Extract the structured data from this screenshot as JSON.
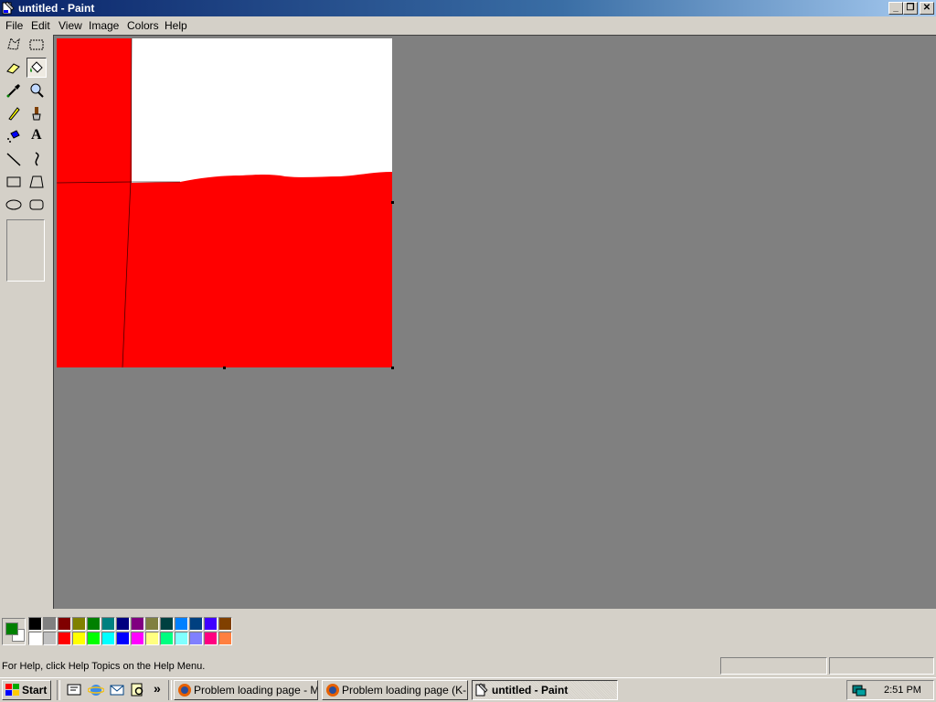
{
  "window": {
    "title": "untitled - Paint",
    "buttons": {
      "minimize": "_",
      "restore": "❐",
      "close": "✕"
    }
  },
  "menu": [
    "File",
    "Edit",
    "View",
    "Image",
    "Colors",
    "Help"
  ],
  "toolbox": {
    "tools": [
      {
        "name": "free-form-select-icon"
      },
      {
        "name": "select-icon"
      },
      {
        "name": "eraser-icon"
      },
      {
        "name": "fill-with-color-icon"
      },
      {
        "name": "pick-color-icon"
      },
      {
        "name": "magnifier-icon"
      },
      {
        "name": "pencil-icon"
      },
      {
        "name": "brush-icon"
      },
      {
        "name": "airbrush-icon"
      },
      {
        "name": "text-icon",
        "glyph": "A"
      },
      {
        "name": "line-icon"
      },
      {
        "name": "curve-icon"
      },
      {
        "name": "rectangle-icon"
      },
      {
        "name": "polygon-icon"
      },
      {
        "name": "ellipse-icon"
      },
      {
        "name": "rounded-rectangle-icon"
      }
    ],
    "selected_tool": "fill-with-color-icon"
  },
  "colors": {
    "foreground": "#008000",
    "background": "#ffffff",
    "workspace": "#808080",
    "canvas_red": "#ff0000",
    "palette_top": [
      "#000000",
      "#808080",
      "#800000",
      "#808000",
      "#008000",
      "#008080",
      "#000080",
      "#800080",
      "#808040",
      "#004040",
      "#0080ff",
      "#004080",
      "#4000ff",
      "#804000"
    ],
    "palette_bottom": [
      "#ffffff",
      "#c0c0c0",
      "#ff0000",
      "#ffff00",
      "#00ff00",
      "#00ffff",
      "#0000ff",
      "#ff00ff",
      "#ffff80",
      "#00ff80",
      "#80ffff",
      "#8080ff",
      "#ff0080",
      "#ff8040"
    ]
  },
  "status": {
    "help_text": "For Help, click Help Topics on the Help Menu."
  },
  "taskbar": {
    "start_label": "Start",
    "quick_launch": [
      "show-desktop-icon",
      "internet-explorer-icon",
      "outlook-icon",
      "search-icon"
    ],
    "more_label": "»",
    "tasks": [
      {
        "label": "Problem loading page - M...",
        "icon": "firefox-icon",
        "active": false
      },
      {
        "label": "Problem loading page (K-...",
        "icon": "firefox-icon",
        "active": false
      },
      {
        "label": "untitled - Paint",
        "icon": "paint-icon",
        "active": true
      }
    ],
    "clock": "2:51 PM"
  }
}
